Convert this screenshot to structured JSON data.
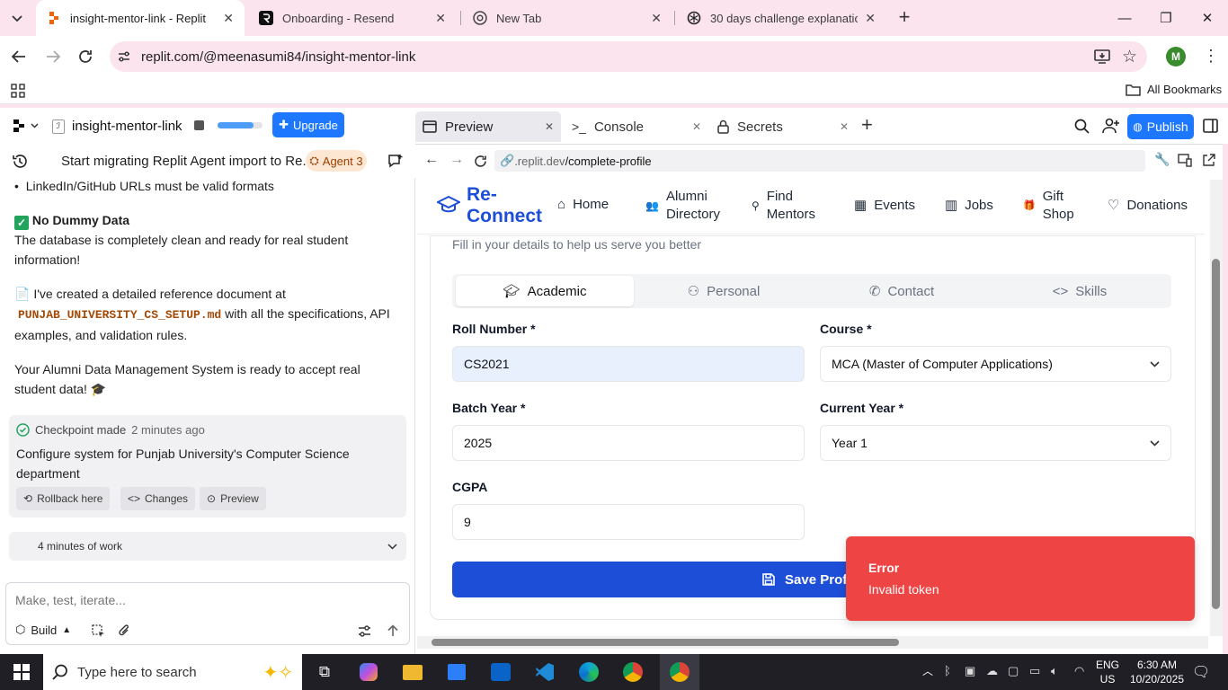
{
  "browser": {
    "tabs": [
      {
        "title": "insight-mentor-link - Replit",
        "active": true
      },
      {
        "title": "Onboarding - Resend",
        "active": false
      },
      {
        "title": "New Tab",
        "active": false
      },
      {
        "title": "30 days challenge explanation",
        "active": false
      }
    ],
    "url": "replit.com/@meenasumi84/insight-mentor-link",
    "bookmarks_label": "All Bookmarks",
    "profile_initial": "M"
  },
  "replit": {
    "project_name": "insight-mentor-link",
    "upgrade_label": "Upgrade",
    "panel_tabs": [
      "Preview",
      "Console",
      "Secrets"
    ],
    "publish_label": "Publish",
    "chat_title": "Start migrating Replit Agent import to Re...",
    "agent_badge": "Agent 3"
  },
  "chat": {
    "line1": "LinkedIn/GitHub URLs must be valid formats",
    "no_dummy_title": "No Dummy Data",
    "no_dummy_text": "The database is completely clean and ready for real student information!",
    "doc_text_before": "I've created a detailed reference document at",
    "doc_file": "PUNJAB_UNIVERSITY_CS_SETUP.md",
    "doc_text_after": "with all the specifications, API examples, and validation rules.",
    "ready_text": "Your Alumni Data Management System is ready to accept real student data! 🎓",
    "checkpoint_label": "Checkpoint made",
    "checkpoint_time": "2 minutes ago",
    "checkpoint_desc": "Configure system for Punjab University's Computer Science department",
    "rollback_label": "Rollback here",
    "changes_label": "Changes",
    "preview_label": "Preview",
    "work_label": "4 minutes of work",
    "input_placeholder": "Make, test, iterate...",
    "build_label": "Build"
  },
  "preview": {
    "url_prefix": ".replit.dev",
    "url_path": "/complete-profile",
    "brand_line1": "Re-",
    "brand_line2": "Connect",
    "nav": [
      "Home",
      "Alumni Directory",
      "Find Mentors",
      "Events",
      "Jobs",
      "Gift Shop",
      "Donations"
    ],
    "subtitle": "Fill in your details to help us serve you better",
    "form_tabs": [
      "Academic",
      "Personal",
      "Contact",
      "Skills"
    ],
    "fields": {
      "roll_label": "Roll Number *",
      "roll_value": "CS2021",
      "course_label": "Course *",
      "course_value": "MCA (Master of Computer Applications)",
      "batch_label": "Batch Year *",
      "batch_value": "2025",
      "year_label": "Current Year *",
      "year_value": "Year 1",
      "cgpa_label": "CGPA",
      "cgpa_value": "9"
    },
    "save_label": "Save Profile",
    "toast_title": "Error",
    "toast_message": "Invalid token"
  },
  "taskbar": {
    "search_placeholder": "Type here to search",
    "lang": "ENG",
    "region": "US",
    "time": "6:30 AM",
    "date": "10/20/2025"
  },
  "colors": {
    "brand_blue": "#1d4ed8",
    "toast_red": "#ef4444",
    "upgrade_blue": "#1e78ff",
    "chrome_pink": "#fbe4ee"
  }
}
